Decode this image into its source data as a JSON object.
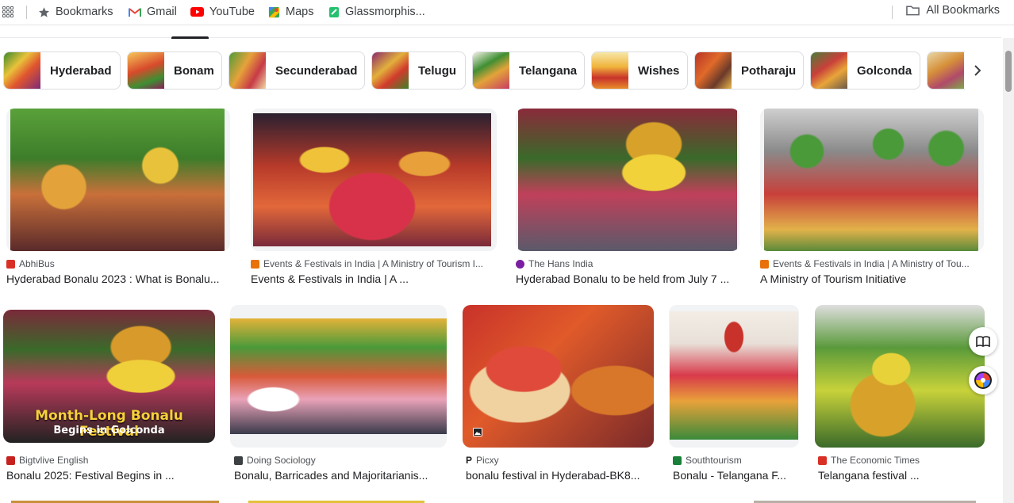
{
  "bookmarks_bar": {
    "items": [
      {
        "label": "Bookmarks",
        "icon": "star-icon"
      },
      {
        "label": "Gmail",
        "icon": "gmail-icon"
      },
      {
        "label": "YouTube",
        "icon": "youtube-icon"
      },
      {
        "label": "Maps",
        "icon": "maps-icon"
      },
      {
        "label": "Glassmorphis...",
        "icon": "glassmorphism-icon"
      }
    ],
    "all_bookmarks": "All Bookmarks"
  },
  "chips": [
    {
      "label": "Hyderabad"
    },
    {
      "label": "Bonam"
    },
    {
      "label": "Secunderabad"
    },
    {
      "label": "Telugu"
    },
    {
      "label": "Telangana"
    },
    {
      "label": "Wishes"
    },
    {
      "label": "Potharaju"
    },
    {
      "label": "Golconda"
    }
  ],
  "results": [
    {
      "source": "AbhiBus",
      "title": "Hyderabad Bonalu 2023 : What is Bonalu...",
      "fav_color": "#d93025"
    },
    {
      "source": "Events & Festivals in India | A Ministry of Tourism I...",
      "title": "Events & Festivals in India | A ...",
      "fav_color": "#e8710a"
    },
    {
      "source": "The Hans India",
      "title": "Hyderabad Bonalu to be held from July 7 ...",
      "fav_color": "#7b1fa2"
    },
    {
      "source": "Events & Festivals in India | A Ministry of Tou...",
      "title": "A Ministry of Tourism Initiative",
      "fav_color": "#e8710a"
    },
    {
      "source": "Bigtvlive English",
      "title": "Bonalu 2025: Festival Begins in ...",
      "fav_color": "#c5221f",
      "overlay": {
        "line1": "Month-Long Bonalu Festival",
        "line2": "Begins in Golconda"
      }
    },
    {
      "source": "Doing Sociology",
      "title": "Bonalu, Barricades and Majoritarianis...",
      "fav_color": "#3c4043"
    },
    {
      "source": "Picxy",
      "title": "bonalu festival in Hyderabad-BK8...",
      "fav_color": "#202124"
    },
    {
      "source": "Southtourism",
      "title": "Bonalu - Telangana F...",
      "fav_color": "#188038"
    },
    {
      "source": "The Economic Times",
      "title": "Telangana festival ...",
      "fav_color": "#d93025"
    }
  ]
}
